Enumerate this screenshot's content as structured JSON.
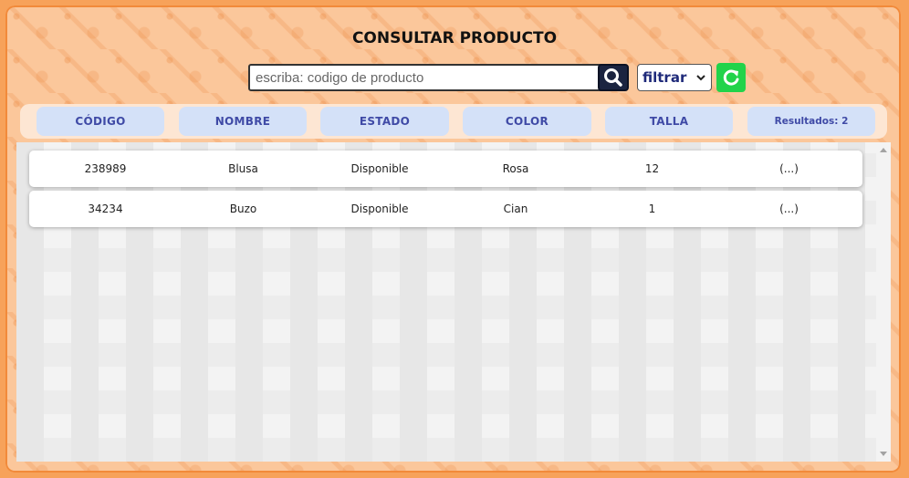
{
  "page": {
    "title": "CONSULTAR PRODUCTO"
  },
  "search": {
    "placeholder": "escriba: codigo de producto",
    "value": ""
  },
  "filter": {
    "selected": "filtrar"
  },
  "colors": {
    "accent_orange": "#f7a25a",
    "search_button": "#1b2440",
    "refresh_button": "#22d34a",
    "header_cell": "#d4e1f8"
  },
  "icons": {
    "search": "search-icon",
    "refresh": "refresh-icon",
    "dropdown": "chevron-down-icon"
  },
  "table": {
    "headers": [
      "CÓDIGO",
      "NOMBRE",
      "ESTADO",
      "COLOR",
      "TALLA"
    ],
    "results_label": "Resultados: 2",
    "rows": [
      {
        "codigo": "238989",
        "nombre": "Blusa",
        "estado": "Disponible",
        "color": "Rosa",
        "talla": "12",
        "more": "(...)"
      },
      {
        "codigo": "34234",
        "nombre": "Buzo",
        "estado": "Disponible",
        "color": "Cian",
        "talla": "1",
        "more": "(...)"
      }
    ]
  }
}
